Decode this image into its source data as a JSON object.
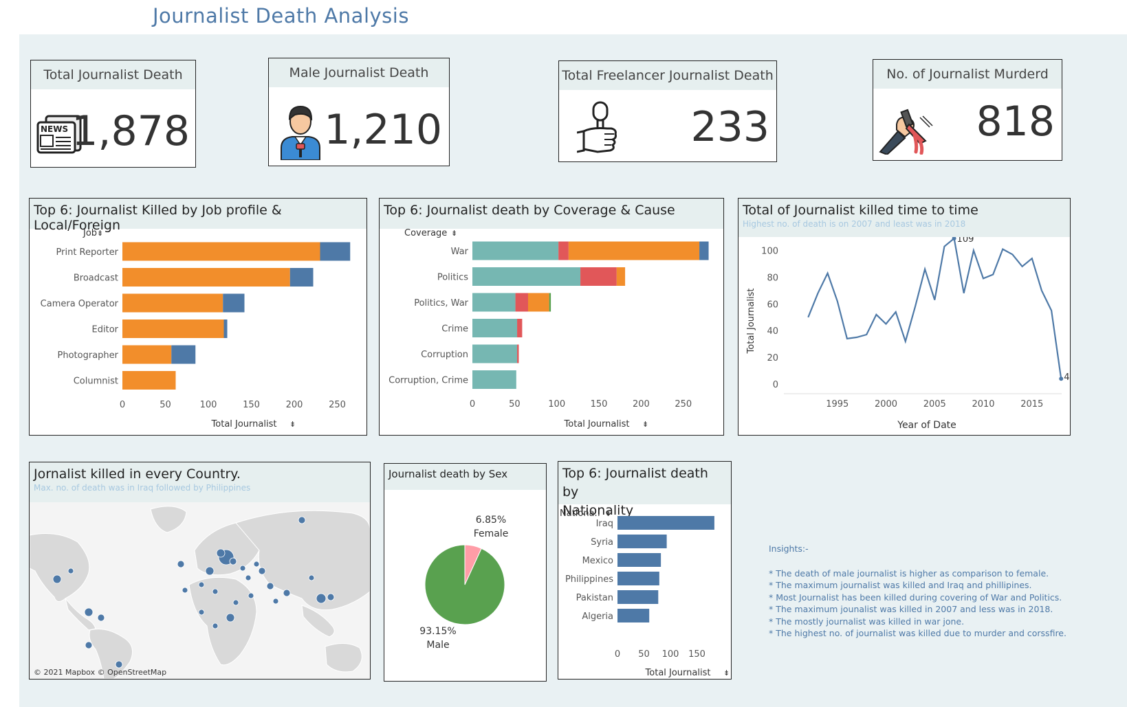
{
  "title": "Journalist Death Analysis",
  "kpis": [
    {
      "label": "Total Journalist Death",
      "value": "1,878",
      "icon": "newspaper-icon"
    },
    {
      "label": "Male Journalist Death",
      "value": "1,210",
      "icon": "reporter-icon"
    },
    {
      "label": "Total Freelancer Journalist Death",
      "value": "233",
      "icon": "microphone-hand-icon"
    },
    {
      "label": "No.  of Journalist Murderd",
      "value": "818",
      "icon": "knife-blood-icon"
    }
  ],
  "colors": {
    "orange": "#f28e2b",
    "blue": "#4e79a7",
    "teal": "#76b7b2",
    "red": "#e15759",
    "green": "#59a14f",
    "pink": "#ff9da7",
    "header_bg": "#e6efef",
    "canvas_bg": "#e9f1f3"
  },
  "job_chart": {
    "title": "Top 6: Journalist Killed by Job profile & Local/Foreign",
    "dim_label": "Job",
    "xlabel": "Total Journalist",
    "ticks": [
      "0",
      "50",
      "100",
      "150",
      "200",
      "250"
    ]
  },
  "coverage_chart": {
    "title": "Top  6: Journalist death by Coverage & Cause",
    "dim_label": "Coverage",
    "xlabel": "Total Journalist",
    "ticks": [
      "0",
      "50",
      "100",
      "150",
      "200",
      "250"
    ]
  },
  "time_chart": {
    "title": "Total of Journalist killed time to time",
    "subtitle": "Highest no. of death is on 2007 and least was in 2018",
    "ylabel": "Total Journalist",
    "xlabel": "Year of Date",
    "yticks": [
      "0",
      "20",
      "40",
      "60",
      "80",
      "100"
    ],
    "xticks": [
      "1995",
      "2000",
      "2005",
      "2010",
      "2015"
    ],
    "max_label": "109",
    "min_label": "4"
  },
  "map": {
    "title": "Jornalist killed in every Country.",
    "subtitle": "Max. no. of death was in Iraq followed by Philippines",
    "credit": "© 2021 Mapbox © OpenStreetMap"
  },
  "sex_chart": {
    "title": "Journalist death by Sex",
    "female_pct": "6.85%",
    "female_label": "Female",
    "male_pct": "93.15%",
    "male_label": "Male"
  },
  "nationality_chart": {
    "title_line1": "Top 6: Journalist  death by",
    "title_line2": "Nationality",
    "dim_label": "Nationa..",
    "xlabel": "Total Journalist",
    "ticks": [
      "0",
      "50",
      "100",
      "150"
    ]
  },
  "insights": {
    "heading": "Insights:-",
    "lines": [
      "* The death of male journalist is higher as comparison to female.",
      "* The maximum journalist was killed and Iraq and phillipines.",
      "* Most Journalist has  been killed during covering of War and  Politics.",
      "* The maximum jounalist was killed in 2007 and less was  in 2018.",
      "* The mostly journalist was killed in war jone.",
      "* The highest no. of journalist was killed due to murder and corssfire."
    ]
  },
  "chart_data": [
    {
      "type": "bar",
      "title": "Top 6: Journalist Killed by Job profile & Local/Foreign",
      "categories": [
        "Print Reporter",
        "Broadcast",
        "Camera Operator",
        "Editor",
        "Photographer",
        "Columnist"
      ],
      "series": [
        {
          "values": [
            230,
            195,
            117,
            118,
            57,
            62
          ],
          "color": "#f28e2b"
        },
        {
          "values": [
            35,
            27,
            25,
            4,
            28,
            0
          ],
          "color": "#4e79a7"
        }
      ],
      "xlabel": "Total Journalist",
      "xlim": [
        0,
        270
      ]
    },
    {
      "type": "bar",
      "title": "Top  6: Journalist death by Coverage & Cause",
      "categories": [
        "War",
        "Politics",
        "Politics, War",
        "Crime",
        "Corruption",
        "Corruption, Crime"
      ],
      "series": [
        {
          "values": [
            102,
            128,
            51,
            53,
            53,
            52
          ],
          "color": "#76b7b2"
        },
        {
          "values": [
            12,
            43,
            15,
            6,
            2,
            0
          ],
          "color": "#e15759"
        },
        {
          "values": [
            155,
            10,
            25,
            0,
            0,
            0
          ],
          "color": "#f28e2b"
        },
        {
          "values": [
            0,
            0,
            2,
            0,
            0,
            0
          ],
          "color": "#59a14f"
        },
        {
          "values": [
            11,
            0,
            0,
            0,
            0,
            0
          ],
          "color": "#4e79a7"
        }
      ],
      "xlabel": "Total Journalist",
      "xlim": [
        0,
        280
      ]
    },
    {
      "type": "line",
      "title": "Total of Journalist killed time to time",
      "x": [
        1992,
        1993,
        1994,
        1995,
        1996,
        1997,
        1998,
        1999,
        2000,
        2001,
        2002,
        2003,
        2004,
        2005,
        2006,
        2007,
        2008,
        2009,
        2010,
        2011,
        2012,
        2013,
        2014,
        2015,
        2016,
        2017,
        2018
      ],
      "y": [
        50,
        68,
        83,
        62,
        34,
        35,
        37,
        52,
        45,
        54,
        32,
        58,
        86,
        63,
        103,
        109,
        68,
        100,
        79,
        82,
        101,
        97,
        88,
        94,
        70,
        55,
        4
      ],
      "xlabel": "Year of Date",
      "ylabel": "Total Journalist",
      "ylim": [
        0,
        110
      ]
    },
    {
      "type": "pie",
      "title": "Journalist death by Sex",
      "categories": [
        "Female",
        "Male"
      ],
      "values": [
        6.85,
        93.15
      ]
    },
    {
      "type": "bar",
      "title": "Top 6: Journalist  death by Nationality",
      "categories": [
        "Iraq",
        "Syria",
        "Mexico",
        "Philippines",
        "Pakistan",
        "Algeria"
      ],
      "values": [
        183,
        93,
        82,
        79,
        77,
        60
      ],
      "xlabel": "Total Journalist",
      "xlim": [
        0,
        185
      ]
    }
  ]
}
